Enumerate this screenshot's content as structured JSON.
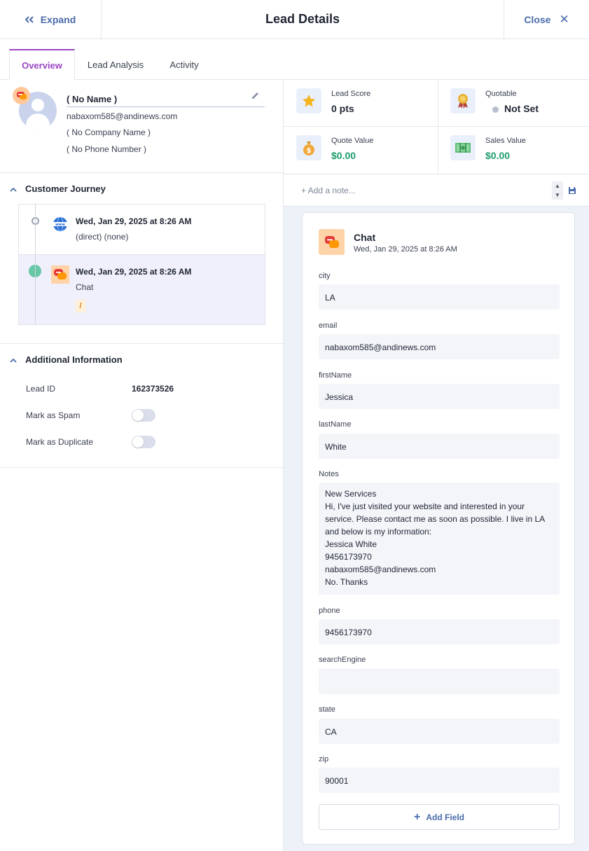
{
  "header": {
    "expand_label": "Expand",
    "title": "Lead Details",
    "close_label": "Close"
  },
  "tabs": [
    {
      "label": "Overview",
      "active": true
    },
    {
      "label": "Lead Analysis",
      "active": false
    },
    {
      "label": "Activity",
      "active": false
    }
  ],
  "profile": {
    "name": "( No Name )",
    "email": "nabaxom585@andinews.com",
    "company": "( No Company Name )",
    "phone": "( No Phone Number )"
  },
  "customer_journey": {
    "title": "Customer Journey",
    "items": [
      {
        "date": "Wed, Jan 29, 2025 at 8:26 AM",
        "detail": "(direct) (none)",
        "icon": "www-globe-icon"
      },
      {
        "date": "Wed, Jan 29, 2025 at 8:26 AM",
        "detail": "Chat",
        "icon": "chat-icon",
        "tag": "/"
      }
    ]
  },
  "additional_info": {
    "title": "Additional Information",
    "lead_id_label": "Lead ID",
    "lead_id_value": "162373526",
    "spam_label": "Mark as Spam",
    "spam_on": false,
    "duplicate_label": "Mark as Duplicate",
    "duplicate_on": false
  },
  "stats": {
    "lead_score": {
      "label": "Lead Score",
      "value": "0 pts"
    },
    "quotable": {
      "label": "Quotable",
      "value": "Not Set"
    },
    "quote_value": {
      "label": "Quote Value",
      "value": "$0.00"
    },
    "sales_value": {
      "label": "Sales Value",
      "value": "$0.00"
    }
  },
  "note": {
    "placeholder": "+ Add a note..."
  },
  "chat_card": {
    "title": "Chat",
    "date": "Wed, Jan 29, 2025 at 8:26 AM",
    "fields": [
      {
        "label": "city",
        "value": "LA"
      },
      {
        "label": "email",
        "value": "nabaxom585@andinews.com"
      },
      {
        "label": "firstName",
        "value": "Jessica"
      },
      {
        "label": "lastName",
        "value": "White"
      },
      {
        "label": "Notes",
        "value": "New Services\nHi, I've just visited your website and interested in your service. Please contact me as soon as possible. I live in LA and below is my information:\nJessica White\n9456173970\nnabaxom585@andinews.com\nNo. Thanks"
      },
      {
        "label": "phone",
        "value": "9456173970"
      },
      {
        "label": "searchEngine",
        "value": ""
      },
      {
        "label": "state",
        "value": "CA"
      },
      {
        "label": "zip",
        "value": "90001"
      }
    ],
    "add_field_label": "Add Field"
  },
  "colors": {
    "accent": "#4a6bab",
    "active_tab": "#9b46c4",
    "money_green": "#1d9c6b",
    "journey_dot": "#68c7a7"
  }
}
